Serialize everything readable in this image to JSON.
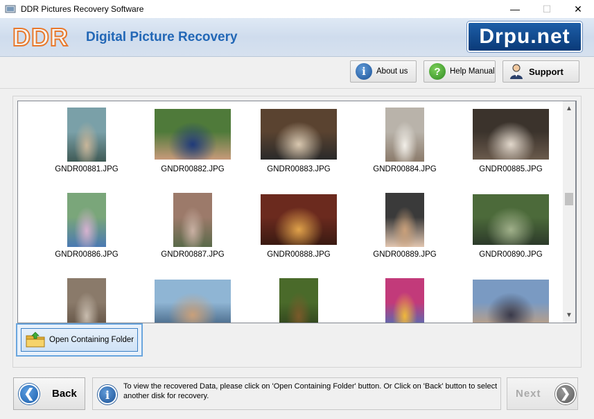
{
  "window": {
    "title": "DDR Pictures Recovery Software",
    "controls": {
      "minimize": "—",
      "maximize": "☐",
      "close": "✕"
    }
  },
  "header": {
    "logo": "DDR",
    "app_name": "Digital Picture Recovery",
    "brand": "Drpu.net"
  },
  "toolbar": {
    "about_label": "About us",
    "help_label": "Help Manual",
    "support_label": "Support"
  },
  "gallery": {
    "items": [
      {
        "filename": "GNDR00881.JPG",
        "icon": "photo-thumbnail",
        "orientation": "portrait",
        "colors": [
          "#7aa0a8",
          "#c8b69a",
          "#3f5a55"
        ]
      },
      {
        "filename": "GNDR00882.JPG",
        "icon": "photo-thumbnail",
        "orientation": "landscape",
        "colors": [
          "#4f7a3a",
          "#1f3a7a",
          "#c89a7a"
        ]
      },
      {
        "filename": "GNDR00883.JPG",
        "icon": "photo-thumbnail",
        "orientation": "landscape",
        "colors": [
          "#5a4330",
          "#d9c8b0",
          "#2a2a2a"
        ]
      },
      {
        "filename": "GNDR00884.JPG",
        "icon": "photo-thumbnail",
        "orientation": "portrait",
        "colors": [
          "#b9b3aa",
          "#f2efe9",
          "#8a7a6a"
        ]
      },
      {
        "filename": "GNDR00885.JPG",
        "icon": "photo-thumbnail",
        "orientation": "landscape",
        "colors": [
          "#3b332c",
          "#e2d8cc",
          "#6a5a4c"
        ]
      },
      {
        "filename": "GNDR00886.JPG",
        "icon": "photo-thumbnail",
        "orientation": "portrait",
        "colors": [
          "#7aa67a",
          "#d6b2d0",
          "#4a79b2"
        ]
      },
      {
        "filename": "GNDR00887.JPG",
        "icon": "photo-thumbnail",
        "orientation": "portrait",
        "colors": [
          "#9c7a6a",
          "#c9b0a3",
          "#5a6a4a"
        ]
      },
      {
        "filename": "GNDR00888.JPG",
        "icon": "photo-thumbnail",
        "orientation": "landscape",
        "colors": [
          "#6b2a1e",
          "#e0a24a",
          "#3a1a12"
        ]
      },
      {
        "filename": "GNDR00889.JPG",
        "icon": "photo-thumbnail",
        "orientation": "portrait",
        "colors": [
          "#3a3a3a",
          "#c9a07a",
          "#e2c6b0"
        ]
      },
      {
        "filename": "GNDR00890.JPG",
        "icon": "photo-thumbnail",
        "orientation": "landscape",
        "colors": [
          "#4c6a3a",
          "#a0b08a",
          "#2c3a2a"
        ]
      },
      {
        "filename": "",
        "icon": "photo-thumbnail",
        "orientation": "portrait",
        "colors": [
          "#8a7a6a",
          "#c8bcae",
          "#5a4a3c"
        ]
      },
      {
        "filename": "",
        "icon": "photo-thumbnail",
        "orientation": "landscape",
        "colors": [
          "#8fb5d4",
          "#c9a07a",
          "#3a5a7a"
        ]
      },
      {
        "filename": "",
        "icon": "photo-thumbnail",
        "orientation": "portrait",
        "colors": [
          "#4a6a2a",
          "#7a5a2a",
          "#2a3a1a"
        ]
      },
      {
        "filename": "",
        "icon": "photo-thumbnail",
        "orientation": "portrait",
        "colors": [
          "#c23a7a",
          "#f0b83a",
          "#3a7ac2"
        ]
      },
      {
        "filename": "",
        "icon": "photo-thumbnail",
        "orientation": "landscape",
        "colors": [
          "#7a9ac2",
          "#3a3a4a",
          "#c9a07a"
        ]
      }
    ]
  },
  "actions": {
    "open_folder_label": "Open Containing Folder",
    "back_label": "Back",
    "next_label": "Next"
  },
  "info": {
    "message": "To view the recovered Data, please click on 'Open Containing Folder' button. Or Click on 'Back' button to select another disk for recovery."
  },
  "colors": {
    "accent": "#2267b6",
    "logo_orange": "#e8792c",
    "focus_border": "#6aa6de"
  }
}
